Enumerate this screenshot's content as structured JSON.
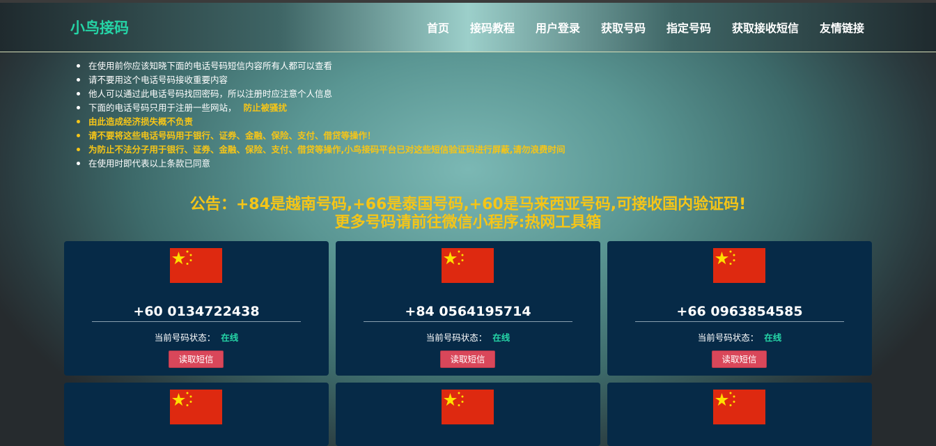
{
  "header": {
    "logo": "小鸟接码",
    "nav": [
      "首页",
      "接码教程",
      "用户登录",
      "获取号码",
      "指定号码",
      "获取接收短信",
      "友情链接"
    ]
  },
  "notices": [
    "在使用前你应该知晓下面的电话号码短信内容所有人都可以查看",
    "请不要用这个电话号码接收重要内容",
    "他人可以通过此电话号码找回密码，所以注册时应注意个人信息",
    "下面的电话号码只用于注册一些网站，",
    "由此造成经济损失概不负责",
    "请不要将这些电话号码用于银行、证券、金融、保险、支付、借贷等操作！",
    "为防止不法分子用于银行、证券、金融、保险、支付、借贷等操作,小鸟接码平台已对这些短信验证码进行屏蔽,请勿浪费时间",
    "在使用时即代表以上条款已同意"
  ],
  "notice_highlight": "防止被骚扰",
  "announcement": {
    "line1": "公告：+84是越南号码,+66是泰国号码,+60是马来西亚号码,可接收国内验证码!",
    "line2": "更多号码请前往微信小程序:热网工具箱"
  },
  "cards": [
    {
      "phone": "+60 0134722438",
      "status_label": "当前号码状态：",
      "status": "在线",
      "button": "读取短信",
      "flag": "china-flag"
    },
    {
      "phone": "+84 0564195714",
      "status_label": "当前号码状态：",
      "status": "在线",
      "button": "读取短信",
      "flag": "china-flag"
    },
    {
      "phone": "+66 0963854585",
      "status_label": "当前号码状态：",
      "status": "在线",
      "button": "读取短信",
      "flag": "china-flag"
    },
    {
      "flag": "china-flag"
    },
    {
      "flag": "china-flag"
    },
    {
      "flag": "china-flag"
    }
  ],
  "colors": {
    "brand": "#25d4a6",
    "warning": "#f5c518",
    "card_bg": "#062a47",
    "button": "#d9475a"
  }
}
